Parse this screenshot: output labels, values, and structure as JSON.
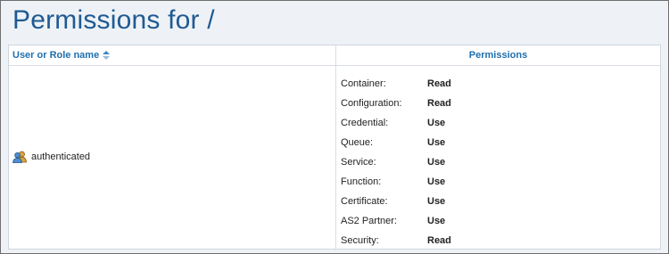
{
  "page": {
    "title": "Permissions for /"
  },
  "table": {
    "headers": {
      "user": "User or Role name",
      "permissions": "Permissions"
    },
    "sort_icon": "sort-ascending-icon",
    "rows": [
      {
        "user_icon": "users-icon",
        "user": "authenticated",
        "permissions": [
          {
            "key": "Container:",
            "value": "Read"
          },
          {
            "key": "Configuration:",
            "value": "Read"
          },
          {
            "key": "Credential:",
            "value": "Use"
          },
          {
            "key": "Queue:",
            "value": "Use"
          },
          {
            "key": "Service:",
            "value": "Use"
          },
          {
            "key": "Function:",
            "value": "Use"
          },
          {
            "key": "Certificate:",
            "value": "Use"
          },
          {
            "key": "AS2 Partner:",
            "value": "Use"
          },
          {
            "key": "Security:",
            "value": "Read"
          }
        ]
      }
    ]
  },
  "colors": {
    "title": "#1f5a93",
    "header_link": "#1f6fae",
    "background": "#eef2f6"
  }
}
